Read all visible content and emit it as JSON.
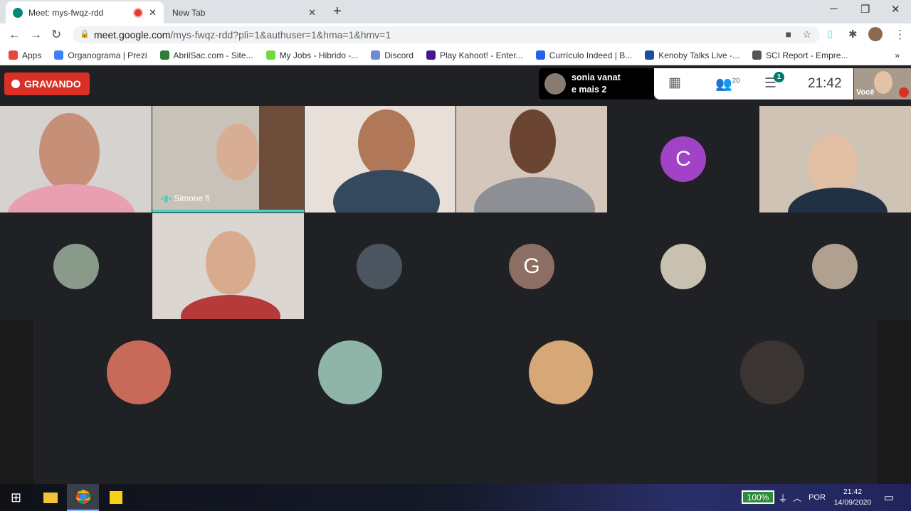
{
  "browser": {
    "tabs": [
      {
        "title": "Meet: mys-fwqz-rdd",
        "recording": true
      },
      {
        "title": "New Tab"
      }
    ],
    "url_host": "meet.google.com",
    "url_path": "/mys-fwqz-rdd?pli=1&authuser=1&hma=1&hmv=1",
    "bookmarks": [
      {
        "label": "Apps",
        "color": "#e8453c"
      },
      {
        "label": "Organograma | Prezi",
        "color": "#3b82f6"
      },
      {
        "label": "AbrilSac.com - Site...",
        "color": "#2e7d32"
      },
      {
        "label": "My Jobs - Hibrido -...",
        "color": "#6fda44"
      },
      {
        "label": "Discord",
        "color": "#7289da"
      },
      {
        "label": "Play Kahoot! - Enter...",
        "color": "#46178f"
      },
      {
        "label": "Currículo Indeed | B...",
        "color": "#2164f3"
      },
      {
        "label": "Kenoby Talks Live -...",
        "color": "#1a4fa0"
      },
      {
        "label": "SCI Report - Empre...",
        "color": "#555555"
      }
    ],
    "more": "»"
  },
  "meet": {
    "recording_label": "GRAVANDO",
    "presenter_name": "sonia vanat",
    "presenter_more": "e mais 2",
    "participants_count": "20",
    "chat_badge": "1",
    "clock": "21:42",
    "self_label": "Você",
    "speaking_name": "Simone fl",
    "avatar_letters": {
      "c": "C",
      "g": "G"
    },
    "colors": {
      "c": "#a142c7",
      "g": "#8d6e63",
      "accent": "#00897b",
      "record": "#d93025"
    }
  },
  "taskbar": {
    "battery": "100%",
    "language": "POR",
    "time": "21:42",
    "date": "14/09/2020"
  }
}
